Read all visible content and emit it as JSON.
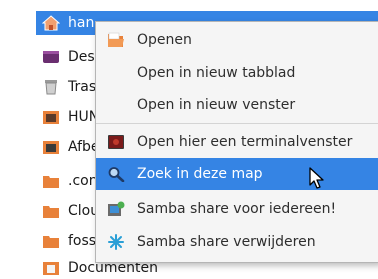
{
  "sidebar": {
    "items": [
      {
        "label": "han",
        "icon": "home-folder-icon"
      },
      {
        "label": "Des",
        "icon": "desktop-icon"
      },
      {
        "label": "Tras",
        "icon": "trash-icon"
      },
      {
        "label": "HUN",
        "icon": "folder-icon"
      },
      {
        "label": "Afbe",
        "icon": "pictures-folder-icon"
      },
      {
        "label": ".con",
        "icon": "folder-icon"
      },
      {
        "label": "Clou",
        "icon": "folder-icon"
      },
      {
        "label": "foss",
        "icon": "folder-icon"
      },
      {
        "label": "Documenten",
        "icon": "documents-folder-icon"
      }
    ],
    "selected_index": 0
  },
  "context_menu": {
    "items": [
      {
        "label": "Openen",
        "icon": "folder-open-icon"
      },
      {
        "label": "Open in nieuw tabblad",
        "icon": ""
      },
      {
        "label": "Open in nieuw venster",
        "icon": ""
      },
      {
        "label": "Open hier een terminalvenster",
        "icon": "terminal-icon"
      },
      {
        "label": "Zoek in deze map",
        "icon": "search-icon"
      },
      {
        "label": "Samba share voor iedereen!",
        "icon": "samba-share-icon"
      },
      {
        "label": "Samba share verwijderen",
        "icon": "samba-remove-icon"
      }
    ],
    "hovered_index": 4
  },
  "colors": {
    "selection": "#3584e4",
    "folder": "#e8813a"
  }
}
